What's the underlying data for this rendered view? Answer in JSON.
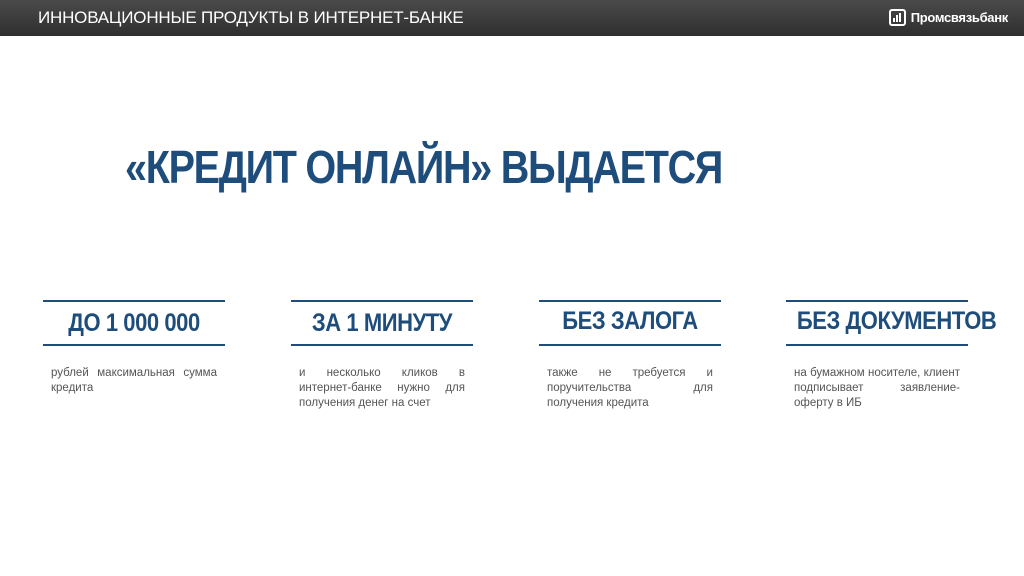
{
  "header": {
    "title": "ИННОВАЦИОННЫЕ ПРОДУКТЫ В ИНТЕРНЕТ-БАНКЕ",
    "logo_text": "Промсвязьбанк"
  },
  "headline": "«КРЕДИТ ОНЛАЙН» ВЫДАЕТСЯ",
  "cards": [
    {
      "title": "ДО 1 000 000",
      "description": "рублей максимальная сумма кредита"
    },
    {
      "title": "ЗА 1 МИНУТУ",
      "description": "и несколько кликов в интернет-банке нужно для получения денег на счет"
    },
    {
      "title": "БЕЗ ЗАЛОГА",
      "description": "также не требуется и поручительства для получения кредита"
    },
    {
      "title": "БЕЗ ДОКУМЕНТОВ",
      "description": "на бумажном носителе, клиент подписывает заявление-оферту в ИБ"
    }
  ],
  "colors": {
    "accent": "#1e4d7b",
    "header_bg": "#3a3a3a",
    "body_text": "#555555"
  }
}
